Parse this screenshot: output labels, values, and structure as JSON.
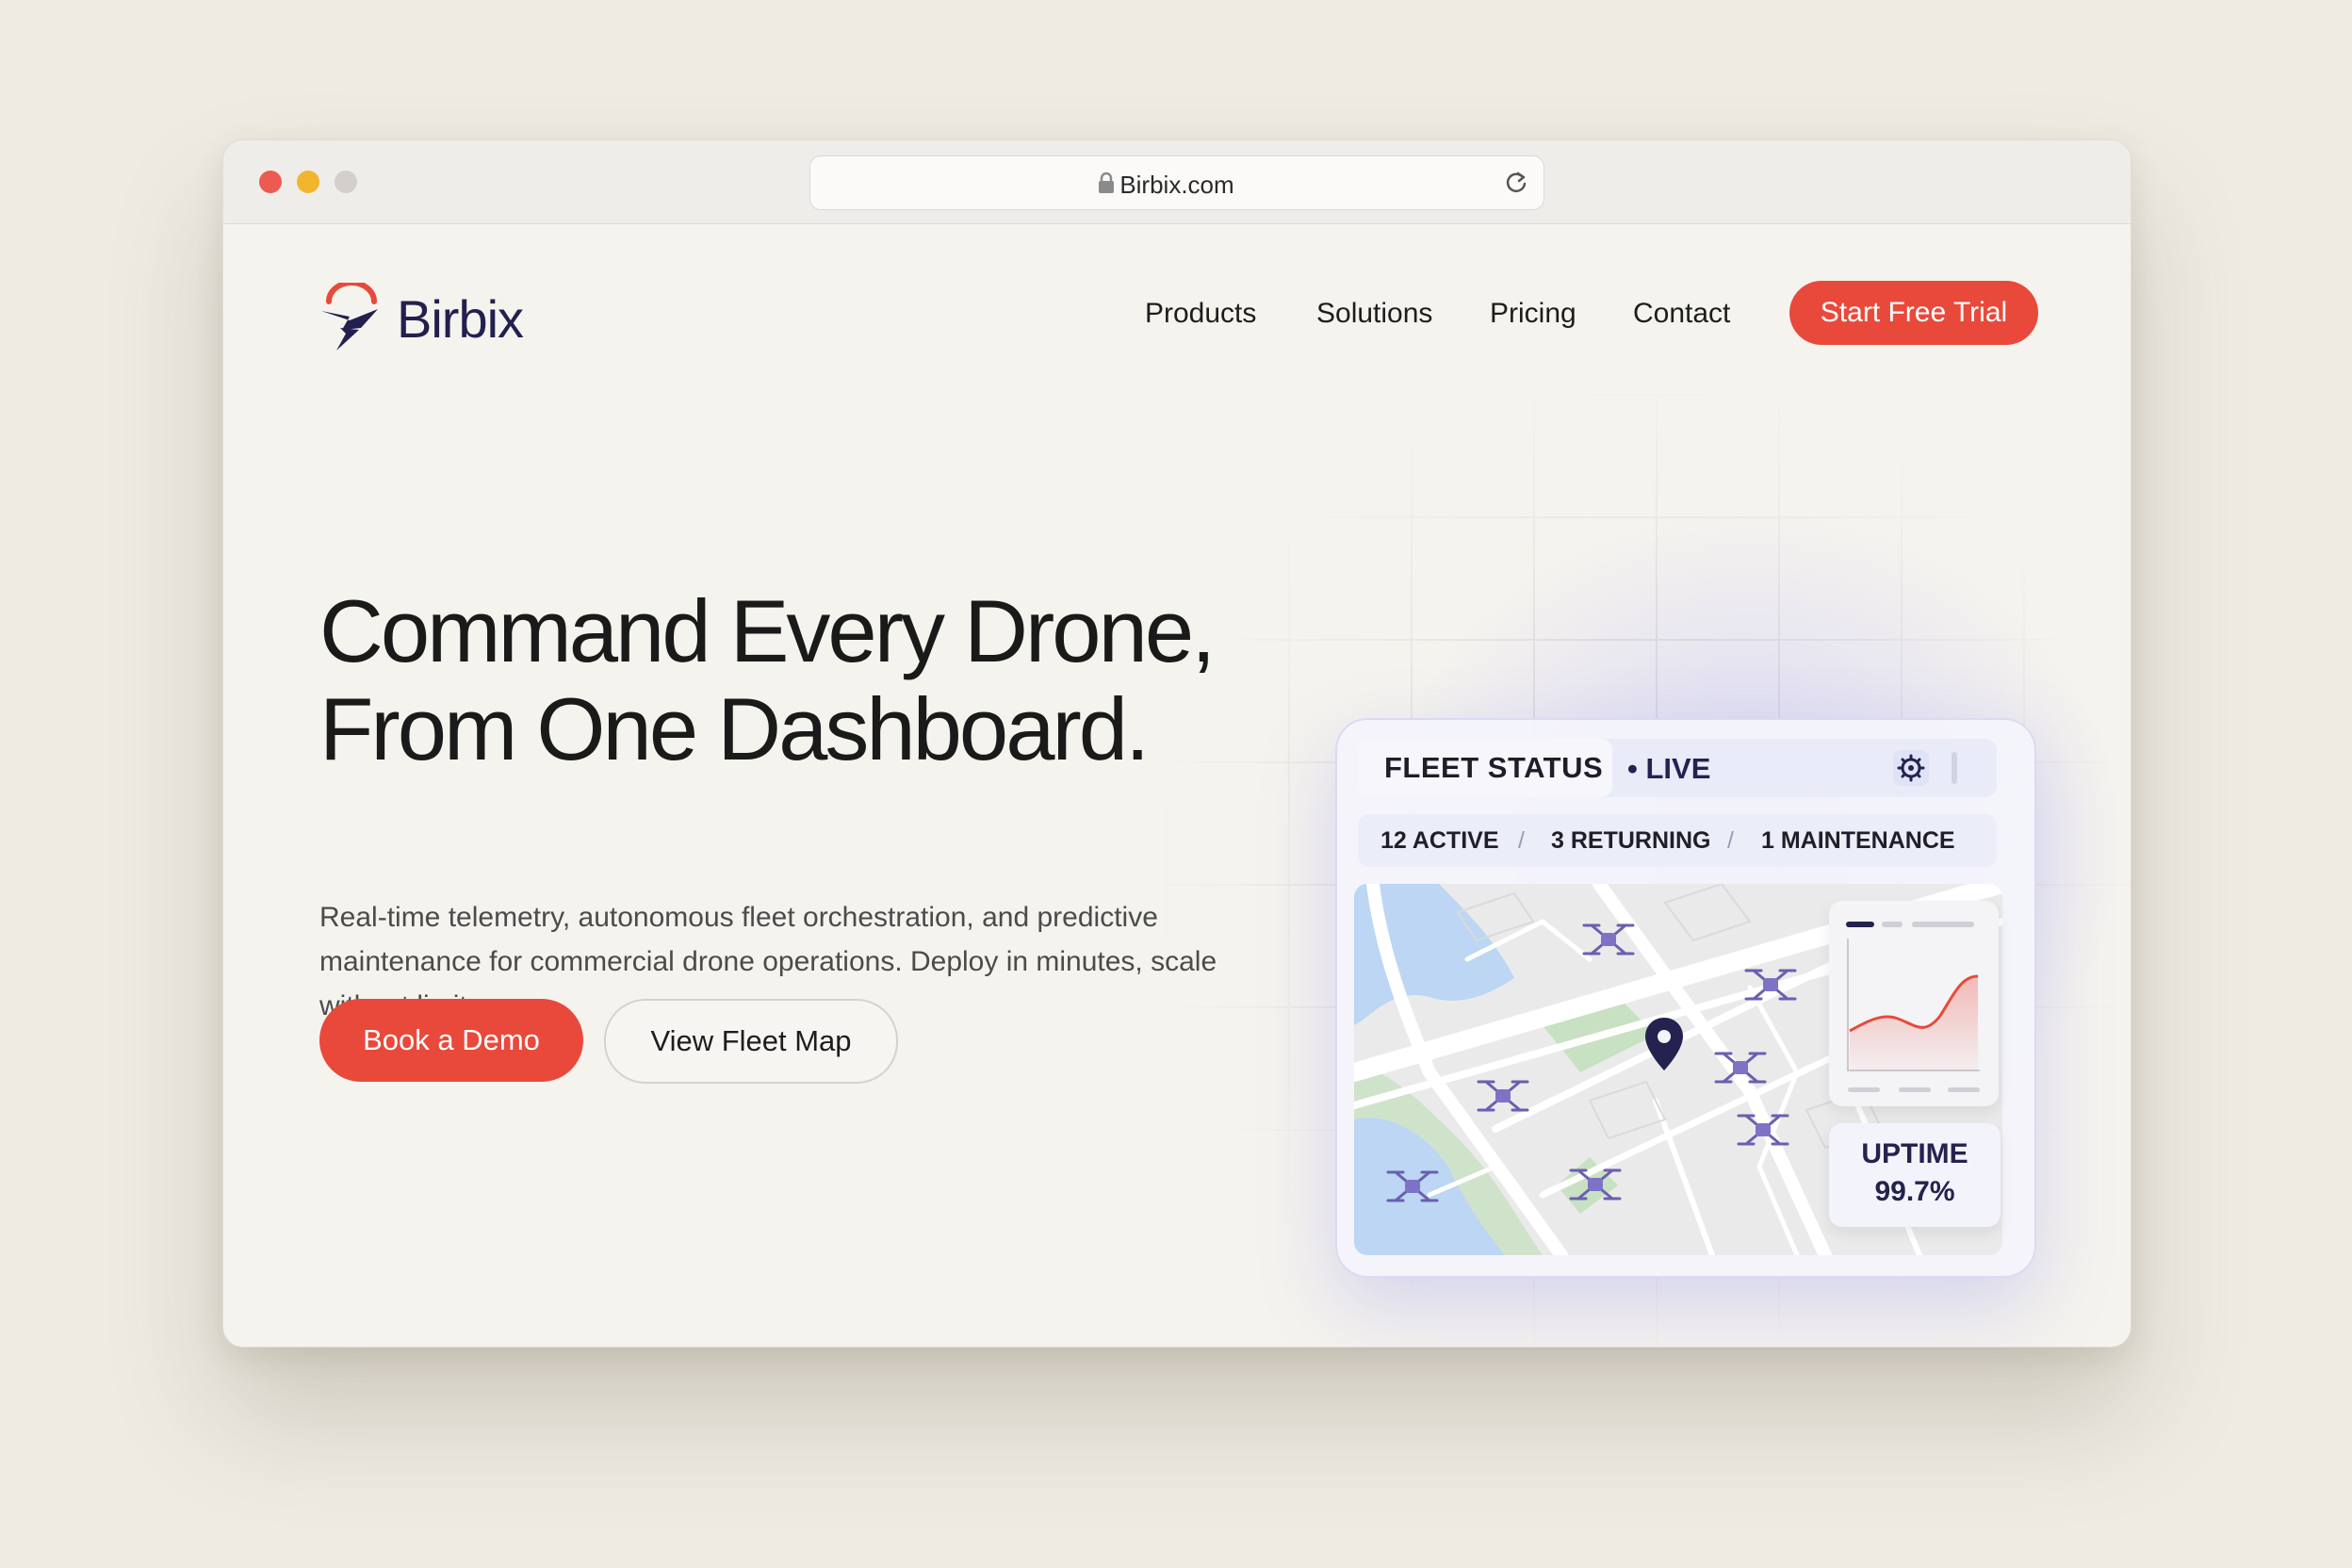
{
  "browser": {
    "url": "Birbix.com"
  },
  "brand": {
    "name": "Birbix",
    "color": "#23204f",
    "accent": "#e9493b"
  },
  "nav": {
    "items": [
      "Products",
      "Solutions",
      "Pricing",
      "Contact"
    ],
    "cta": "Start Free Trial"
  },
  "hero": {
    "headline_line1": "Command Every Drone,",
    "headline_line2": "From One Dashboard.",
    "subtext": "Real-time telemetry, autonomous fleet orchestration, and predictive maintenance for commercial drone operations. Deploy in minutes, scale without limits.",
    "primary_button": "Book a Demo",
    "secondary_button": "View Fleet Map"
  },
  "dashboard": {
    "title": "FLEET STATUS",
    "live": "• LIVE",
    "active": "12 ACTIVE",
    "returning": "3 RETURNING",
    "maintenance": "1 MAINTENANCE",
    "separator": "/",
    "uptime_label": "UPTIME",
    "uptime_value": "99.7%"
  },
  "icons": {
    "logo": "bird-logo-icon",
    "lock": "lock-icon",
    "reload": "reload-icon",
    "gear": "gear-icon",
    "pin": "map-pin-icon",
    "drone": "drone-icon"
  }
}
